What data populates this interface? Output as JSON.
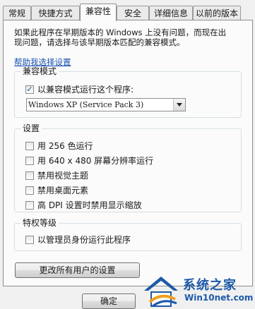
{
  "tabs": [
    {
      "label": "常规"
    },
    {
      "label": "快捷方式"
    },
    {
      "label": "兼容性"
    },
    {
      "label": "安全"
    },
    {
      "label": "详细信息"
    },
    {
      "label": "以前的版本"
    }
  ],
  "active_tab": "兼容性",
  "description_line1": "如果此程序在早期版本的 Windows 上没有问题，而现在出",
  "description_line2": "现问题，请选择与该早期版本匹配的兼容模式。",
  "help_link": "帮助我选择设置",
  "compat_group": {
    "title": "兼容模式",
    "checkbox_label": "以兼容模式运行这个程序:",
    "checked": true,
    "selected_os": "Windows XP (Service Pack 3)"
  },
  "settings_group": {
    "title": "设置",
    "options": [
      {
        "label": "用 256 色运行",
        "checked": false
      },
      {
        "label": "用 640 x 480 屏幕分辨率运行",
        "checked": false
      },
      {
        "label": "禁用视觉主题",
        "checked": false
      },
      {
        "label": "禁用桌面元素",
        "checked": false
      },
      {
        "label": "高 DPI 设置时禁用显示缩放",
        "checked": false
      }
    ]
  },
  "privilege_group": {
    "title": "特权等级",
    "checkbox_label": "以管理员身份运行此程序",
    "checked": false
  },
  "all_users_button": "更改所有用户的设置",
  "ok_button": "确定",
  "watermark": {
    "title": "系统之家",
    "url": "Win10net.com"
  },
  "colors": {
    "link": "#1a52b0",
    "watermark": "#1d5aa8",
    "panel_bg": "#fbfbfb",
    "window_bg": "#f0f0f0"
  }
}
